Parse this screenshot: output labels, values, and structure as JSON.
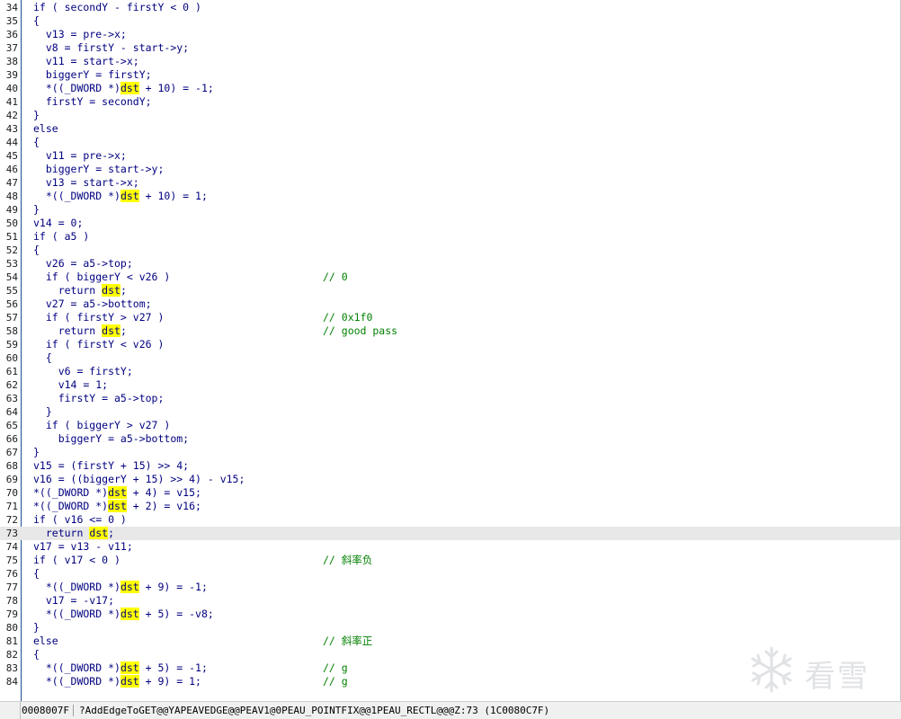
{
  "editor": {
    "lines": [
      {
        "num": "34",
        "code": "if ( secondY - firstY < 0 )",
        "comment": ""
      },
      {
        "num": "35",
        "code": "{",
        "comment": ""
      },
      {
        "num": "36",
        "code": "  v13 = pre->x;",
        "comment": ""
      },
      {
        "num": "37",
        "code": "  v8 = firstY - start->y;",
        "comment": ""
      },
      {
        "num": "38",
        "code": "  v11 = start->x;",
        "comment": ""
      },
      {
        "num": "39",
        "code": "  biggerY = firstY;",
        "comment": ""
      },
      {
        "num": "40",
        "code": "  *((_DWORD *)dst + 10) = -1;",
        "comment": ""
      },
      {
        "num": "41",
        "code": "  firstY = secondY;",
        "comment": ""
      },
      {
        "num": "42",
        "code": "}",
        "comment": ""
      },
      {
        "num": "43",
        "code": "else",
        "comment": ""
      },
      {
        "num": "44",
        "code": "{",
        "comment": ""
      },
      {
        "num": "45",
        "code": "  v11 = pre->x;",
        "comment": ""
      },
      {
        "num": "46",
        "code": "  biggerY = start->y;",
        "comment": ""
      },
      {
        "num": "47",
        "code": "  v13 = start->x;",
        "comment": ""
      },
      {
        "num": "48",
        "code": "  *((_DWORD *)dst + 10) = 1;",
        "comment": ""
      },
      {
        "num": "49",
        "code": "}",
        "comment": ""
      },
      {
        "num": "50",
        "code": "v14 = 0;",
        "comment": ""
      },
      {
        "num": "51",
        "code": "if ( a5 )",
        "comment": ""
      },
      {
        "num": "52",
        "code": "{",
        "comment": ""
      },
      {
        "num": "53",
        "code": "  v26 = a5->top;",
        "comment": ""
      },
      {
        "num": "54",
        "code": "  if ( biggerY < v26 )",
        "comment": "// 0"
      },
      {
        "num": "55",
        "code": "    return dst;",
        "comment": ""
      },
      {
        "num": "56",
        "code": "  v27 = a5->bottom;",
        "comment": ""
      },
      {
        "num": "57",
        "code": "  if ( firstY > v27 )",
        "comment": "// 0x1f0"
      },
      {
        "num": "58",
        "code": "    return dst;",
        "comment": "// good pass"
      },
      {
        "num": "59",
        "code": "  if ( firstY < v26 )",
        "comment": ""
      },
      {
        "num": "60",
        "code": "  {",
        "comment": ""
      },
      {
        "num": "61",
        "code": "    v6 = firstY;",
        "comment": ""
      },
      {
        "num": "62",
        "code": "    v14 = 1;",
        "comment": ""
      },
      {
        "num": "63",
        "code": "    firstY = a5->top;",
        "comment": ""
      },
      {
        "num": "64",
        "code": "  }",
        "comment": ""
      },
      {
        "num": "65",
        "code": "  if ( biggerY > v27 )",
        "comment": ""
      },
      {
        "num": "66",
        "code": "    biggerY = a5->bottom;",
        "comment": ""
      },
      {
        "num": "67",
        "code": "}",
        "comment": ""
      },
      {
        "num": "68",
        "code": "v15 = (firstY + 15) >> 4;",
        "comment": ""
      },
      {
        "num": "69",
        "code": "v16 = ((biggerY + 15) >> 4) - v15;",
        "comment": ""
      },
      {
        "num": "70",
        "code": "*((_DWORD *)dst + 4) = v15;",
        "comment": ""
      },
      {
        "num": "71",
        "code": "*((_DWORD *)dst + 2) = v16;",
        "comment": ""
      },
      {
        "num": "72",
        "code": "if ( v16 <= 0 )",
        "comment": ""
      },
      {
        "num": "73",
        "code": "  return dst;",
        "comment": ""
      },
      {
        "num": "74",
        "code": "v17 = v13 - v11;",
        "comment": ""
      },
      {
        "num": "75",
        "code": "if ( v17 < 0 )",
        "comment": "// 斜率负"
      },
      {
        "num": "76",
        "code": "{",
        "comment": ""
      },
      {
        "num": "77",
        "code": "  *((_DWORD *)dst + 9) = -1;",
        "comment": ""
      },
      {
        "num": "78",
        "code": "  v17 = -v17;",
        "comment": ""
      },
      {
        "num": "79",
        "code": "  *((_DWORD *)dst + 5) = -v8;",
        "comment": ""
      },
      {
        "num": "80",
        "code": "}",
        "comment": ""
      },
      {
        "num": "81",
        "code": "else",
        "comment": "// 斜率正"
      },
      {
        "num": "82",
        "code": "{",
        "comment": ""
      },
      {
        "num": "83",
        "code": "  *((_DWORD *)dst + 5) = -1;",
        "comment": "// g"
      },
      {
        "num": "84",
        "code": "  *((_DWORD *)dst + 9) = 1;",
        "comment": "// g"
      }
    ],
    "current_line": "73",
    "highlight_token": "dst"
  },
  "status_bar": {
    "address": "0008007F",
    "function_location": "?AddEdgeToGET@@YAPEAVEDGE@@PEAV1@0PEAU_POINTFIX@@1PEAU_RECTL@@@Z:73 (1C0080C7F)"
  },
  "watermark": {
    "text": "看雪",
    "icon": "snowflake-icon"
  },
  "colors": {
    "code_text": "#000080",
    "comment": "#008000",
    "highlight": "#ffff00",
    "current_line_bg": "#e8e8e8",
    "gutter_border": "#1a4f9a"
  }
}
